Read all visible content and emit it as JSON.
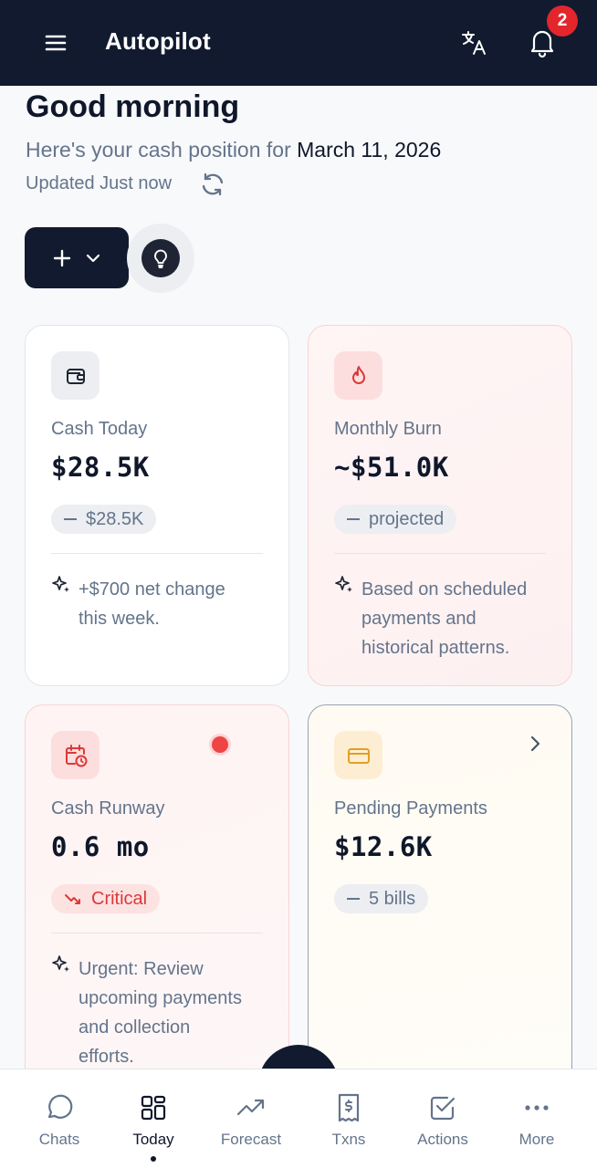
{
  "header": {
    "title": "Autopilot",
    "notification_count": "2",
    "icons": [
      "menu-icon",
      "translate-icon",
      "bell-icon"
    ]
  },
  "greeting": {
    "title": "Good morning",
    "subtitle_prefix": "Here's your cash position for ",
    "date": "March 11, 2026",
    "updated": "Updated Just now"
  },
  "actions": {
    "add_icon": "plus-icon",
    "dropdown_icon": "chevron-down-icon",
    "idea_icon": "lightbulb-icon"
  },
  "cards": [
    {
      "label": "Cash Today",
      "value": "$28.5K",
      "pill": "$28.5K",
      "insight": [
        "+$700 net change",
        "this week."
      ],
      "icon": "wallet-icon"
    },
    {
      "label": "Monthly Burn",
      "value": "~$51.0K",
      "pill": "projected",
      "insight": [
        "Based on scheduled",
        "payments and",
        "historical patterns."
      ],
      "icon": "flame-icon"
    },
    {
      "label": "Cash Runway",
      "value": "0.6 mo",
      "pill": "Critical",
      "insight": [
        "Urgent: Review",
        "upcoming payments",
        "and collection",
        "efforts."
      ],
      "icon": "calendar-clock-icon",
      "status_color": "#ef4444"
    },
    {
      "label": "Pending Payments",
      "value": "$12.6K",
      "pill": "5 bills",
      "icon": "credit-card-icon"
    }
  ],
  "nav": [
    {
      "label": "Chats",
      "icon": "chat-icon"
    },
    {
      "label": "Today",
      "icon": "grid-icon",
      "active": true
    },
    {
      "label": "Forecast",
      "icon": "trend-up-icon"
    },
    {
      "label": "Txns",
      "icon": "receipt-icon"
    },
    {
      "label": "Actions",
      "icon": "checkbox-icon"
    },
    {
      "label": "More",
      "icon": "more-icon"
    }
  ],
  "colors": {
    "header_bg": "#111a2e",
    "accent_red": "#e3262c",
    "critical": "#d93a3a"
  }
}
